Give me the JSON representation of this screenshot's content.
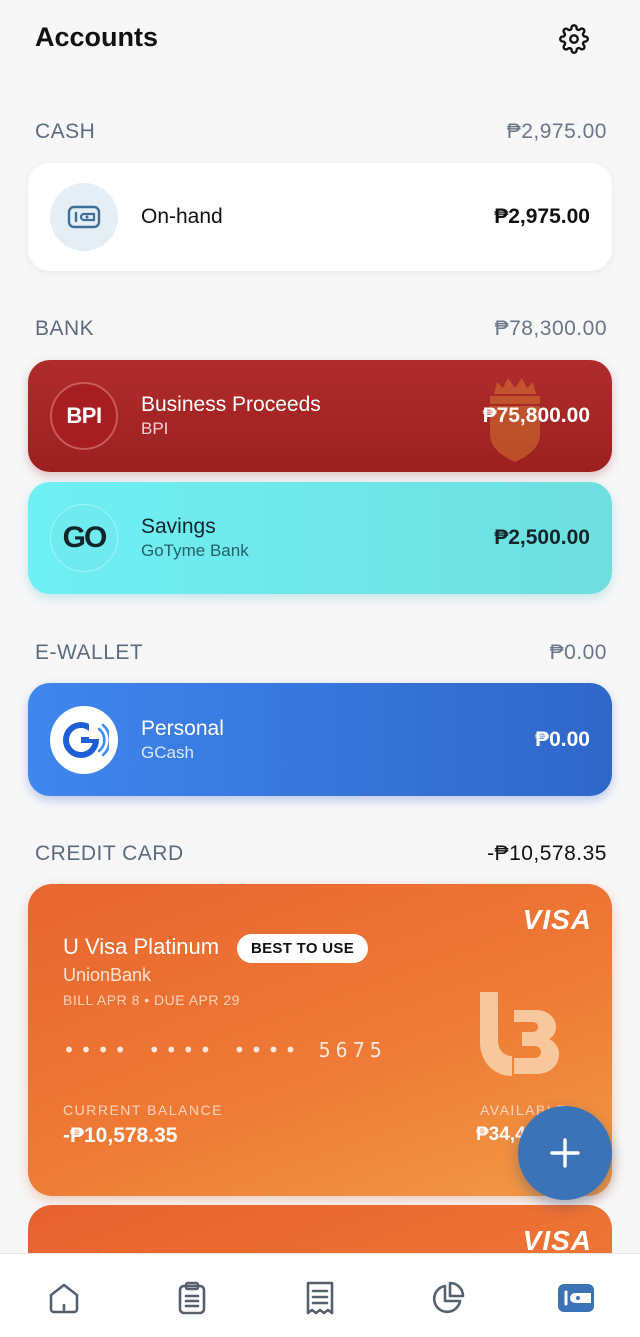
{
  "header": {
    "title": "Accounts",
    "settings_icon": "gear-icon"
  },
  "sections": {
    "cash": {
      "name": "CASH",
      "total": "₱2,975.00"
    },
    "bank": {
      "name": "BANK",
      "total": "₱78,300.00"
    },
    "ewallet": {
      "name": "E-WALLET",
      "total": "₱0.00"
    },
    "credit": {
      "name": "CREDIT CARD",
      "total": "-₱10,578.35"
    }
  },
  "accounts": {
    "onhand": {
      "name": "On-hand",
      "amount": "₱2,975.00",
      "icon": "wallet-icon"
    },
    "bpi": {
      "name": "Business Proceeds",
      "bank": "BPI",
      "amount": "₱75,800.00",
      "logo_text": "BPI",
      "color": "#a8272a"
    },
    "gotyme": {
      "name": "Savings",
      "bank": "GoTyme Bank",
      "amount": "₱2,500.00",
      "logo_text": "GO",
      "color": "#6ff0f4"
    },
    "gcash": {
      "name": "Personal",
      "bank": "GCash",
      "amount": "₱0.00",
      "logo_text": "G",
      "color": "#3a7ae0"
    }
  },
  "credit_card": {
    "network": "VISA",
    "name": "U Visa Platinum",
    "badge": "BEST TO USE",
    "bank": "UnionBank",
    "bill": "BILL APR 8 • DUE APR 29",
    "number": "•••• •••• •••• 5675",
    "current_balance_label": "CURRENT BALANCE",
    "current_balance": "-₱10,578.35",
    "available_label": "AVAILABLE",
    "available": "₱34,4",
    "color": "#ec7434"
  },
  "credit_card_2": {
    "network": "VISA"
  },
  "fab": {
    "icon": "plus-icon"
  },
  "bottom_nav": [
    "home-icon",
    "clipboard-icon",
    "receipt-icon",
    "pie-chart-icon",
    "wallet-icon"
  ]
}
